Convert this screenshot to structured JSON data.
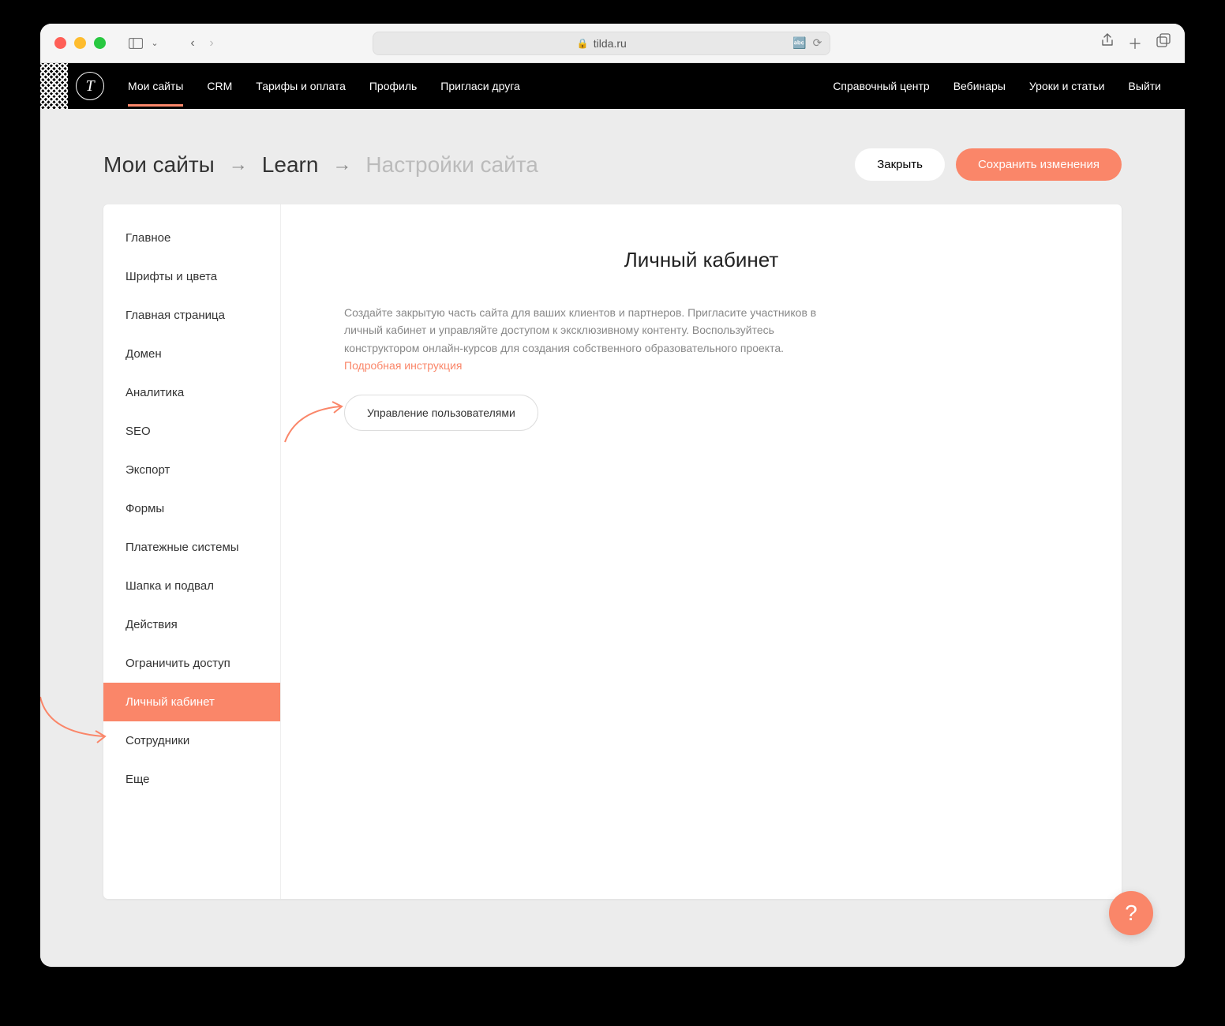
{
  "browser": {
    "url": "tilda.ru"
  },
  "topnav": {
    "logo_letter": "T",
    "left": [
      "Мои сайты",
      "CRM",
      "Тарифы и оплата",
      "Профиль",
      "Пригласи друга"
    ],
    "right": [
      "Справочный центр",
      "Вебинары",
      "Уроки и статьи",
      "Выйти"
    ],
    "active_index": 0
  },
  "breadcrumbs": {
    "items": [
      "Мои сайты",
      "Learn",
      "Настройки сайта"
    ]
  },
  "buttons": {
    "close": "Закрыть",
    "save": "Сохранить изменения"
  },
  "sidebar": {
    "items": [
      "Главное",
      "Шрифты и цвета",
      "Главная страница",
      "Домен",
      "Аналитика",
      "SEO",
      "Экспорт",
      "Формы",
      "Платежные системы",
      "Шапка и подвал",
      "Действия",
      "Ограничить доступ",
      "Личный кабинет",
      "Сотрудники",
      "Еще"
    ],
    "active_index": 12
  },
  "main": {
    "title": "Личный кабинет",
    "description": "Создайте закрытую часть сайта для ваших клиентов и партнеров. Пригласите участников в личный кабинет и управляйте доступом к эксклюзивному контенту. Воспользуйтесь конструктором онлайн-курсов для создания собственного образовательного проекта. ",
    "link_text": "Подробная инструкция",
    "manage_button": "Управление пользователями"
  },
  "help": {
    "label": "?"
  }
}
